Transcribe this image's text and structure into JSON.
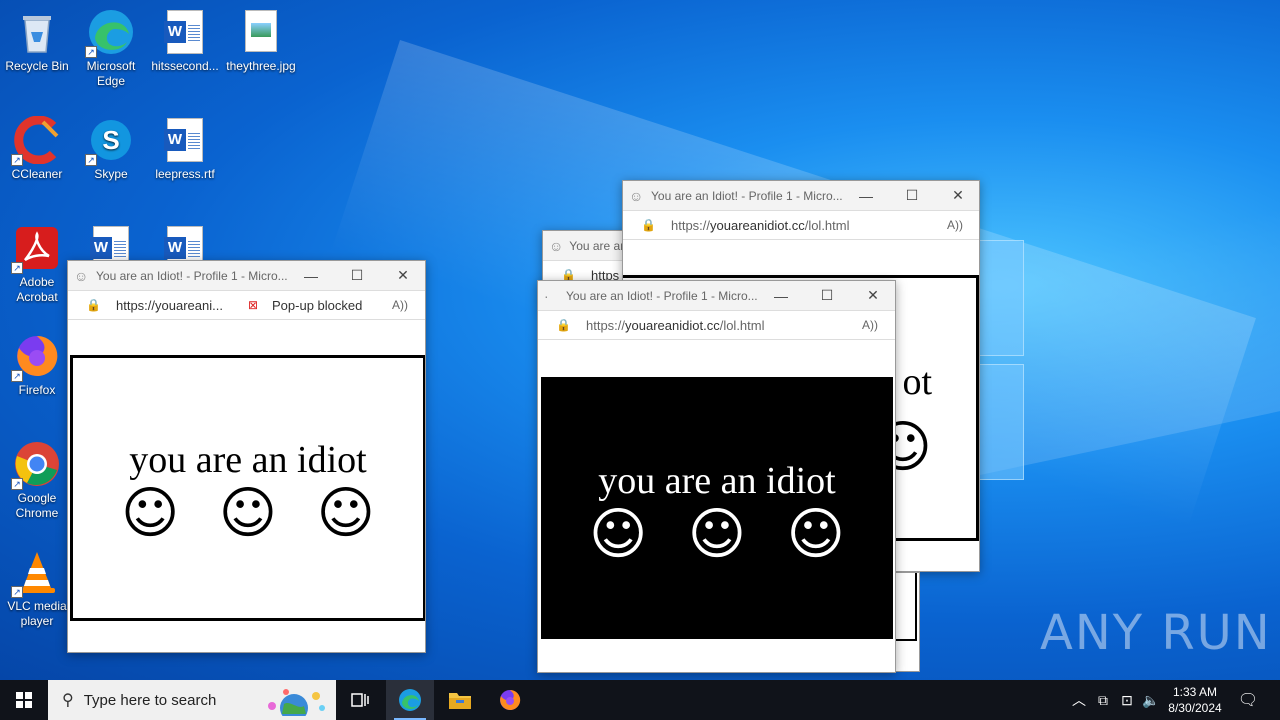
{
  "desktop_icons": [
    {
      "label": "Recycle Bin",
      "icon": "recycle-bin-icon"
    },
    {
      "label": "Microsoft Edge",
      "icon": "edge-icon"
    },
    {
      "label": "hitssecond...",
      "icon": "word-document-icon"
    },
    {
      "label": "theythree.jpg",
      "icon": "image-file-icon"
    },
    {
      "label": "CCleaner",
      "icon": "ccleaner-icon"
    },
    {
      "label": "Skype",
      "icon": "skype-icon"
    },
    {
      "label": "leepress.rtf",
      "icon": "word-document-icon"
    },
    {
      "label": "Adobe Acrobat",
      "icon": "acrobat-icon"
    },
    {
      "label": "Firefox",
      "icon": "firefox-icon"
    },
    {
      "label": "Google Chrome",
      "icon": "chrome-icon"
    },
    {
      "label": "VLC media player",
      "icon": "vlc-icon"
    }
  ],
  "windows": {
    "title": "You are an Idiot! - Profile 1 - Micro...",
    "back_title": "You are an",
    "url_full_prefix": "https://",
    "url_domain": "youareanidiot.cc",
    "url_path": "/lol.html",
    "url_truncated": "https://youareani...",
    "popup_blocked": "Pop-up blocked",
    "partial_url": "https",
    "message": "you are an idiot",
    "partial_message": "ot"
  },
  "taskbar": {
    "search_placeholder": "Type here to search",
    "time": "1:33 AM",
    "date": "8/30/2024"
  },
  "watermark": "ANY RUN",
  "colors": {
    "accent": "#0a63d0",
    "taskbar": "#10131a"
  }
}
